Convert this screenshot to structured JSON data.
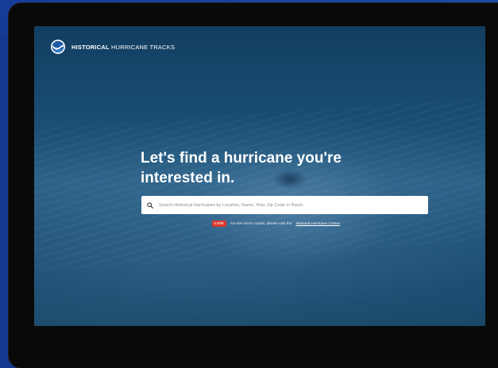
{
  "brand": {
    "bold": "HISTORICAL",
    "light": " HURRICANE TRACKS",
    "logo_icon": "noaa-logo-icon"
  },
  "hero": {
    "title": "Let's find a hurricane you're interested in."
  },
  "search": {
    "placeholder": "Search Historical Hurricanes by Location, Name, Year, Zip Code or Basin",
    "value": "",
    "icon": "search-icon"
  },
  "live_notice": {
    "badge": "LIVE",
    "text": "For live storm tracks, please visit the",
    "link": "National Hurricane Center",
    "suffix": "."
  },
  "colors": {
    "page_background": "#14388f",
    "bezel": "#090909",
    "live_badge": "#d8372c",
    "screen_tint": "#1a4e74"
  }
}
